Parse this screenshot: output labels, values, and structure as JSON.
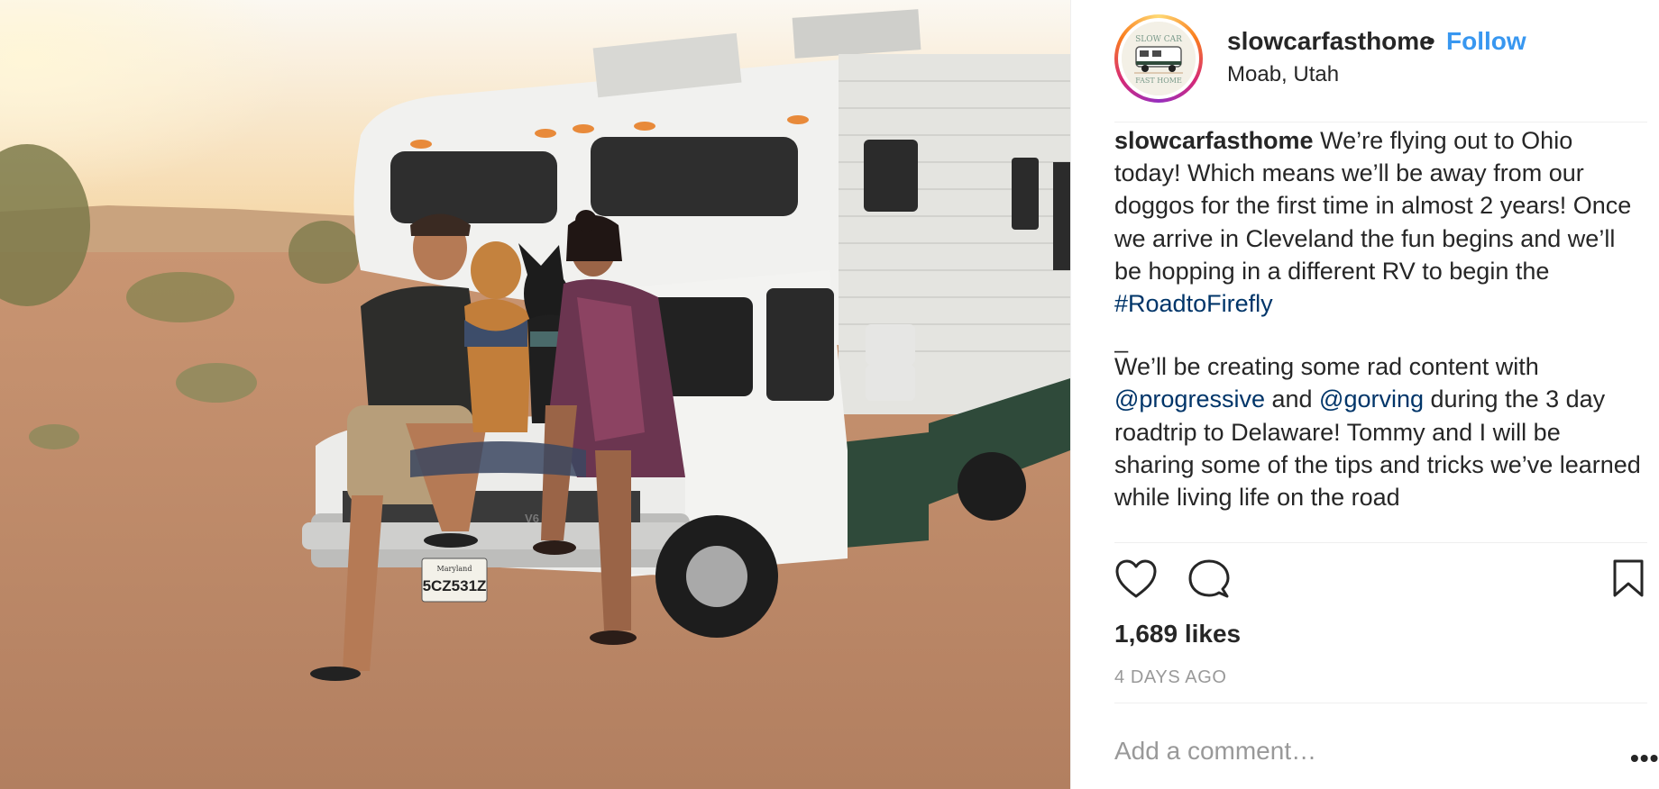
{
  "post": {
    "username": "slowcarfasthome",
    "separator": "•",
    "follow_label": "Follow",
    "location": "Moab, Utah",
    "avatar_text_top": "SLOW CAR",
    "avatar_text_bottom": "FAST HOME",
    "license_plate": "5CZ531Z",
    "plate_state": "Maryland",
    "truck_badge": "V6"
  },
  "caption": {
    "username": "slowcarfasthome",
    "text_1": " We’re flying out to Ohio today! Which means we’ll be away from our doggos for the first time in almost 2 years! Once we arrive in Cleveland the fun begins and we’ll be hopping in a different RV to begin the ",
    "hashtag": "#RoadtoFirefly",
    "separator": "_",
    "text_2": "We’ll be creating some rad content with ",
    "mention_1": "@progressive",
    "text_3": " and ",
    "mention_2": "@gorving",
    "text_4": " during the 3 day roadtrip to Delaware! Tommy and I will be sharing some of the tips and tricks we’ve learned while living life on the road"
  },
  "stats": {
    "likes": "1,689 likes",
    "timestamp": "4 DAYS AGO"
  },
  "comment": {
    "placeholder": "Add a comment…",
    "more_label": "•••"
  },
  "icons": {
    "like": "heart-icon",
    "comment": "comment-icon",
    "save": "bookmark-icon"
  },
  "colors": {
    "follow": "#3897f0",
    "link": "#003569",
    "muted": "#999999",
    "text": "#262626"
  }
}
